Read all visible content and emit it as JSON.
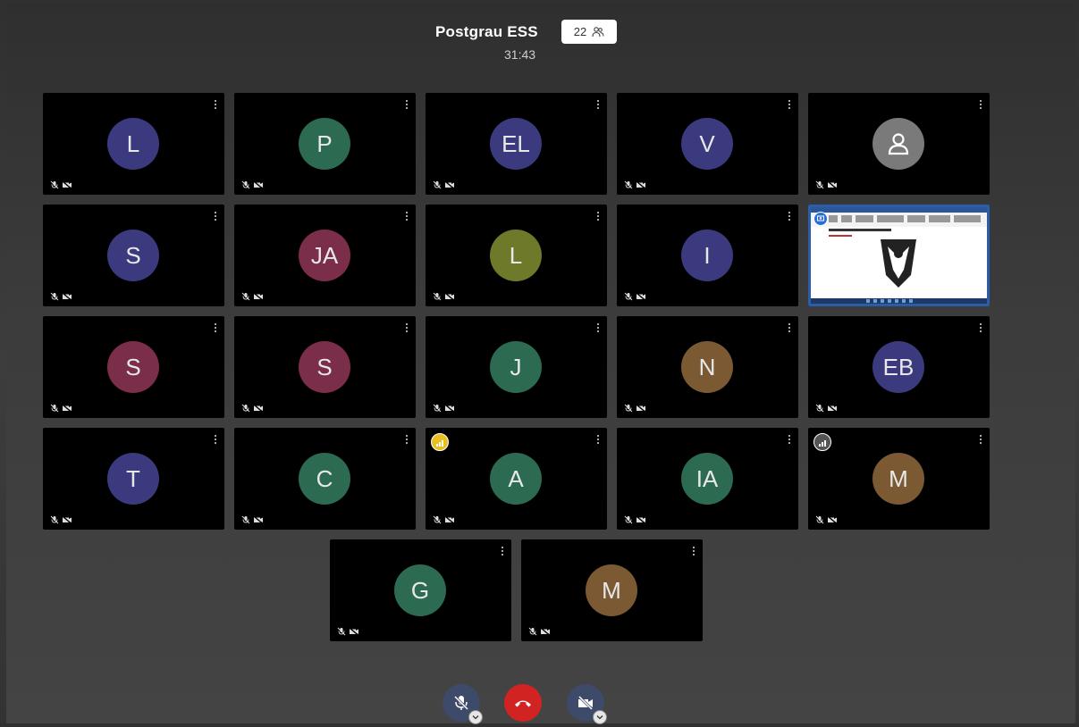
{
  "meeting": {
    "title": "Postgrau ESS",
    "participant_count": "22",
    "elapsed": "31:43"
  },
  "colors": {
    "blue": "#3b3a7e",
    "green": "#2c6a52",
    "maroon": "#7a2e49",
    "olive": "#6e7a2a",
    "bronze": "#7b5a33",
    "grey": "#7a7a7a",
    "hangup": "#d22323",
    "control": "#3e4a6a"
  },
  "participants": [
    {
      "initials": "L",
      "color": "blue"
    },
    {
      "initials": "P",
      "color": "green"
    },
    {
      "initials": "EL",
      "color": "blue"
    },
    {
      "initials": "V",
      "color": "blue"
    },
    {
      "initials": "",
      "color": "grey",
      "icon": "person-icon"
    },
    {
      "initials": "S",
      "color": "blue"
    },
    {
      "initials": "JA",
      "color": "maroon"
    },
    {
      "initials": "L",
      "color": "olive"
    },
    {
      "initials": "I",
      "color": "blue"
    },
    {
      "initials": "",
      "color": "screen",
      "screen_share": true
    },
    {
      "initials": "S",
      "color": "maroon"
    },
    {
      "initials": "S",
      "color": "maroon"
    },
    {
      "initials": "J",
      "color": "green"
    },
    {
      "initials": "N",
      "color": "bronze"
    },
    {
      "initials": "EB",
      "color": "blue"
    },
    {
      "initials": "T",
      "color": "blue"
    },
    {
      "initials": "C",
      "color": "green"
    },
    {
      "initials": "A",
      "color": "green",
      "speaking": "active"
    },
    {
      "initials": "IA",
      "color": "green"
    },
    {
      "initials": "M",
      "color": "bronze",
      "speaking": "idle"
    },
    {
      "initials": "G",
      "color": "green"
    },
    {
      "initials": "M",
      "color": "bronze"
    }
  ],
  "controls": {
    "mic": "mic-muted-icon",
    "hangup": "hangup-icon",
    "camera": "camera-off-icon"
  }
}
